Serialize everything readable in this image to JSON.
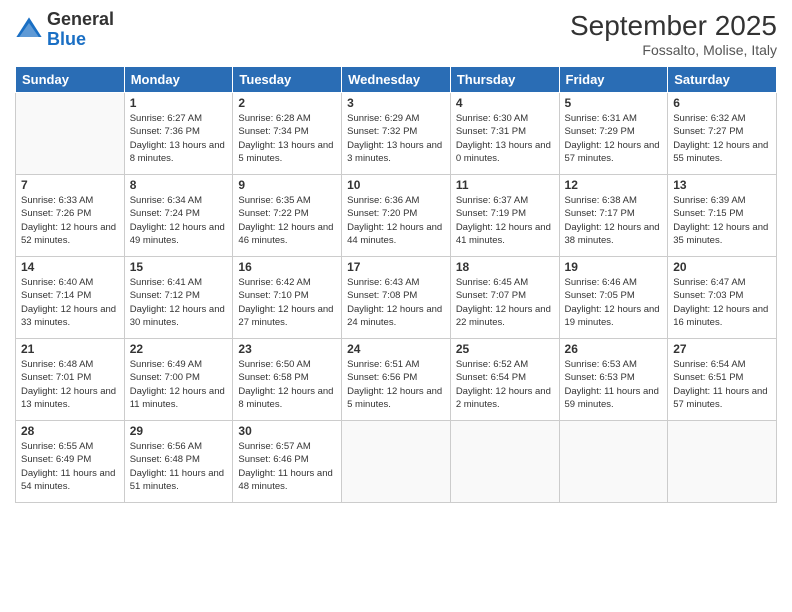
{
  "header": {
    "logo_general": "General",
    "logo_blue": "Blue",
    "month_year": "September 2025",
    "location": "Fossalto, Molise, Italy"
  },
  "weekdays": [
    "Sunday",
    "Monday",
    "Tuesday",
    "Wednesday",
    "Thursday",
    "Friday",
    "Saturday"
  ],
  "weeks": [
    [
      {
        "day": "",
        "sunrise": "",
        "sunset": "",
        "daylight": ""
      },
      {
        "day": "1",
        "sunrise": "Sunrise: 6:27 AM",
        "sunset": "Sunset: 7:36 PM",
        "daylight": "Daylight: 13 hours and 8 minutes."
      },
      {
        "day": "2",
        "sunrise": "Sunrise: 6:28 AM",
        "sunset": "Sunset: 7:34 PM",
        "daylight": "Daylight: 13 hours and 5 minutes."
      },
      {
        "day": "3",
        "sunrise": "Sunrise: 6:29 AM",
        "sunset": "Sunset: 7:32 PM",
        "daylight": "Daylight: 13 hours and 3 minutes."
      },
      {
        "day": "4",
        "sunrise": "Sunrise: 6:30 AM",
        "sunset": "Sunset: 7:31 PM",
        "daylight": "Daylight: 13 hours and 0 minutes."
      },
      {
        "day": "5",
        "sunrise": "Sunrise: 6:31 AM",
        "sunset": "Sunset: 7:29 PM",
        "daylight": "Daylight: 12 hours and 57 minutes."
      },
      {
        "day": "6",
        "sunrise": "Sunrise: 6:32 AM",
        "sunset": "Sunset: 7:27 PM",
        "daylight": "Daylight: 12 hours and 55 minutes."
      }
    ],
    [
      {
        "day": "7",
        "sunrise": "Sunrise: 6:33 AM",
        "sunset": "Sunset: 7:26 PM",
        "daylight": "Daylight: 12 hours and 52 minutes."
      },
      {
        "day": "8",
        "sunrise": "Sunrise: 6:34 AM",
        "sunset": "Sunset: 7:24 PM",
        "daylight": "Daylight: 12 hours and 49 minutes."
      },
      {
        "day": "9",
        "sunrise": "Sunrise: 6:35 AM",
        "sunset": "Sunset: 7:22 PM",
        "daylight": "Daylight: 12 hours and 46 minutes."
      },
      {
        "day": "10",
        "sunrise": "Sunrise: 6:36 AM",
        "sunset": "Sunset: 7:20 PM",
        "daylight": "Daylight: 12 hours and 44 minutes."
      },
      {
        "day": "11",
        "sunrise": "Sunrise: 6:37 AM",
        "sunset": "Sunset: 7:19 PM",
        "daylight": "Daylight: 12 hours and 41 minutes."
      },
      {
        "day": "12",
        "sunrise": "Sunrise: 6:38 AM",
        "sunset": "Sunset: 7:17 PM",
        "daylight": "Daylight: 12 hours and 38 minutes."
      },
      {
        "day": "13",
        "sunrise": "Sunrise: 6:39 AM",
        "sunset": "Sunset: 7:15 PM",
        "daylight": "Daylight: 12 hours and 35 minutes."
      }
    ],
    [
      {
        "day": "14",
        "sunrise": "Sunrise: 6:40 AM",
        "sunset": "Sunset: 7:14 PM",
        "daylight": "Daylight: 12 hours and 33 minutes."
      },
      {
        "day": "15",
        "sunrise": "Sunrise: 6:41 AM",
        "sunset": "Sunset: 7:12 PM",
        "daylight": "Daylight: 12 hours and 30 minutes."
      },
      {
        "day": "16",
        "sunrise": "Sunrise: 6:42 AM",
        "sunset": "Sunset: 7:10 PM",
        "daylight": "Daylight: 12 hours and 27 minutes."
      },
      {
        "day": "17",
        "sunrise": "Sunrise: 6:43 AM",
        "sunset": "Sunset: 7:08 PM",
        "daylight": "Daylight: 12 hours and 24 minutes."
      },
      {
        "day": "18",
        "sunrise": "Sunrise: 6:45 AM",
        "sunset": "Sunset: 7:07 PM",
        "daylight": "Daylight: 12 hours and 22 minutes."
      },
      {
        "day": "19",
        "sunrise": "Sunrise: 6:46 AM",
        "sunset": "Sunset: 7:05 PM",
        "daylight": "Daylight: 12 hours and 19 minutes."
      },
      {
        "day": "20",
        "sunrise": "Sunrise: 6:47 AM",
        "sunset": "Sunset: 7:03 PM",
        "daylight": "Daylight: 12 hours and 16 minutes."
      }
    ],
    [
      {
        "day": "21",
        "sunrise": "Sunrise: 6:48 AM",
        "sunset": "Sunset: 7:01 PM",
        "daylight": "Daylight: 12 hours and 13 minutes."
      },
      {
        "day": "22",
        "sunrise": "Sunrise: 6:49 AM",
        "sunset": "Sunset: 7:00 PM",
        "daylight": "Daylight: 12 hours and 11 minutes."
      },
      {
        "day": "23",
        "sunrise": "Sunrise: 6:50 AM",
        "sunset": "Sunset: 6:58 PM",
        "daylight": "Daylight: 12 hours and 8 minutes."
      },
      {
        "day": "24",
        "sunrise": "Sunrise: 6:51 AM",
        "sunset": "Sunset: 6:56 PM",
        "daylight": "Daylight: 12 hours and 5 minutes."
      },
      {
        "day": "25",
        "sunrise": "Sunrise: 6:52 AM",
        "sunset": "Sunset: 6:54 PM",
        "daylight": "Daylight: 12 hours and 2 minutes."
      },
      {
        "day": "26",
        "sunrise": "Sunrise: 6:53 AM",
        "sunset": "Sunset: 6:53 PM",
        "daylight": "Daylight: 11 hours and 59 minutes."
      },
      {
        "day": "27",
        "sunrise": "Sunrise: 6:54 AM",
        "sunset": "Sunset: 6:51 PM",
        "daylight": "Daylight: 11 hours and 57 minutes."
      }
    ],
    [
      {
        "day": "28",
        "sunrise": "Sunrise: 6:55 AM",
        "sunset": "Sunset: 6:49 PM",
        "daylight": "Daylight: 11 hours and 54 minutes."
      },
      {
        "day": "29",
        "sunrise": "Sunrise: 6:56 AM",
        "sunset": "Sunset: 6:48 PM",
        "daylight": "Daylight: 11 hours and 51 minutes."
      },
      {
        "day": "30",
        "sunrise": "Sunrise: 6:57 AM",
        "sunset": "Sunset: 6:46 PM",
        "daylight": "Daylight: 11 hours and 48 minutes."
      },
      {
        "day": "",
        "sunrise": "",
        "sunset": "",
        "daylight": ""
      },
      {
        "day": "",
        "sunrise": "",
        "sunset": "",
        "daylight": ""
      },
      {
        "day": "",
        "sunrise": "",
        "sunset": "",
        "daylight": ""
      },
      {
        "day": "",
        "sunrise": "",
        "sunset": "",
        "daylight": ""
      }
    ]
  ]
}
